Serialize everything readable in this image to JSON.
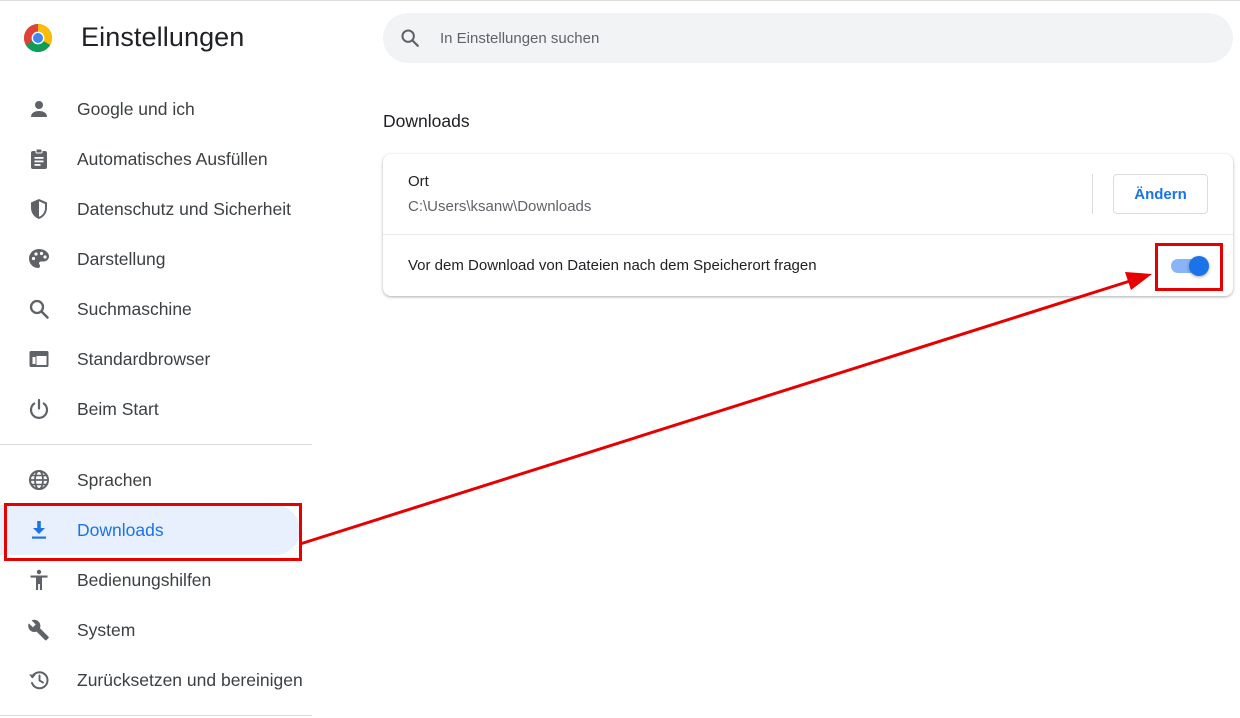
{
  "header": {
    "title": "Einstellungen",
    "search_placeholder": "In Einstellungen suchen"
  },
  "sidebar": {
    "items": [
      {
        "label": "Google und ich",
        "icon": "person-icon"
      },
      {
        "label": "Automatisches Ausfüllen",
        "icon": "clipboard-icon"
      },
      {
        "label": "Datenschutz und Sicherheit",
        "icon": "shield-icon"
      },
      {
        "label": "Darstellung",
        "icon": "palette-icon"
      },
      {
        "label": "Suchmaschine",
        "icon": "search-icon"
      },
      {
        "label": "Standardbrowser",
        "icon": "browser-window-icon"
      },
      {
        "label": "Beim Start",
        "icon": "power-icon"
      },
      {
        "label": "Sprachen",
        "icon": "globe-icon"
      },
      {
        "label": "Downloads",
        "icon": "download-icon",
        "active": true
      },
      {
        "label": "Bedienungshilfen",
        "icon": "accessibility-icon"
      },
      {
        "label": "System",
        "icon": "wrench-icon"
      },
      {
        "label": "Zurücksetzen und bereinigen",
        "icon": "restore-icon"
      }
    ]
  },
  "main": {
    "section_title": "Downloads",
    "location": {
      "label": "Ort",
      "path": "C:\\Users\\ksanw\\Downloads",
      "change_button": "Ändern"
    },
    "ask_location": {
      "label": "Vor dem Download von Dateien nach dem Speicherort fragen",
      "enabled": true
    }
  },
  "colors": {
    "accent": "#1a73e8",
    "active_bg": "#e8f0fe",
    "annotation": "#e60000"
  }
}
